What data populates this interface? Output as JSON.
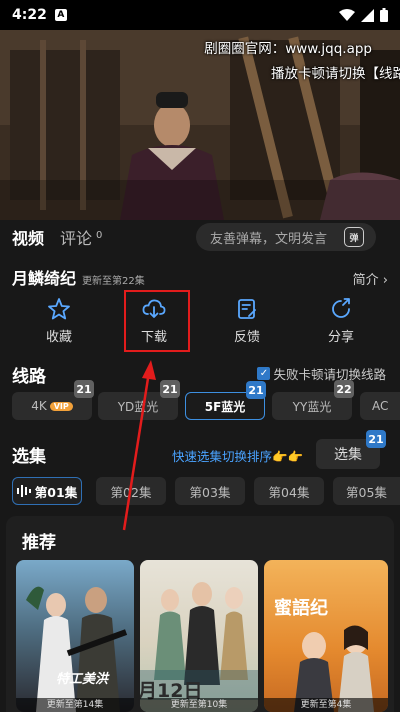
{
  "status": {
    "time": "4:22",
    "app_badge": "A"
  },
  "video": {
    "overlay_line1": "剧圈圈官网：www.jqq.app",
    "overlay_line2": "播放卡顿请切换【线路"
  },
  "tabs": {
    "video": "视频",
    "comments": "评论",
    "comments_count": "0"
  },
  "danmaku": {
    "placeholder": "友善弹幕，文明发言",
    "button": "弹"
  },
  "show": {
    "title": "月鳞绮纪",
    "update": "更新至第22集",
    "intro": "简介 ›"
  },
  "actions": [
    {
      "label": "收藏",
      "icon": "star-icon"
    },
    {
      "label": "下载",
      "icon": "download-icon"
    },
    {
      "label": "反馈",
      "icon": "feedback-icon"
    },
    {
      "label": "分享",
      "icon": "share-icon"
    }
  ],
  "routes": {
    "title": "线路",
    "auto_switch": "失败卡顿请切换线路",
    "items": [
      {
        "label": "4K",
        "vip": "VIP",
        "badge": "21"
      },
      {
        "label": "YD蓝光",
        "badge": "21"
      },
      {
        "label": "5F蓝光",
        "badge": "21"
      },
      {
        "label": "YY蓝光",
        "badge": "22"
      },
      {
        "label": "AC",
        "badge": ""
      }
    ]
  },
  "episodes": {
    "title": "选集",
    "sort_hint": "快速选集切换排序👉👉",
    "select_button": "选集",
    "select_badge": "21",
    "items": [
      "第01集",
      "第02集",
      "第03集",
      "第04集",
      "第05集"
    ]
  },
  "recommend": {
    "title": "推荐",
    "posters": [
      {
        "caption": "更新至第14集",
        "art_text": "特工美洪"
      },
      {
        "caption": "更新至第10集",
        "art_text": "月12日"
      },
      {
        "caption": "更新至第4集",
        "art_text": "蜜語纪"
      }
    ]
  },
  "colors": {
    "accent": "#2f79c8",
    "highlight": "#e21c1c",
    "link": "#4aa3ff",
    "vip": "#f2a13a"
  }
}
